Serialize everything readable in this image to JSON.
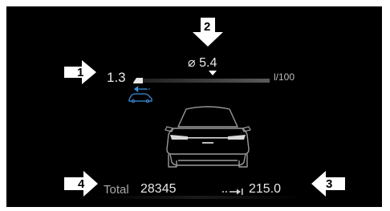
{
  "consumption": {
    "current": "1.3",
    "average_symbol": "⌀",
    "average": "5.4",
    "unit": "l/100",
    "average_marker_fraction": 0.58,
    "current_fill_fraction": 0.07
  },
  "odometer": {
    "total_label": "Total",
    "total_value": "28345",
    "trip_value": "215.0"
  },
  "callouts": {
    "one": "1",
    "two": "2",
    "three": "3",
    "four": "4"
  },
  "icons": {
    "recuperation": "car-recuperation-icon",
    "trip": "trip-arrow-icon",
    "vehicle": "car-rear-icon"
  },
  "colors": {
    "background": "#000000",
    "accent_blue": "#3b8fd9",
    "text": "#e8e8e8",
    "callout": "#ffffff"
  }
}
